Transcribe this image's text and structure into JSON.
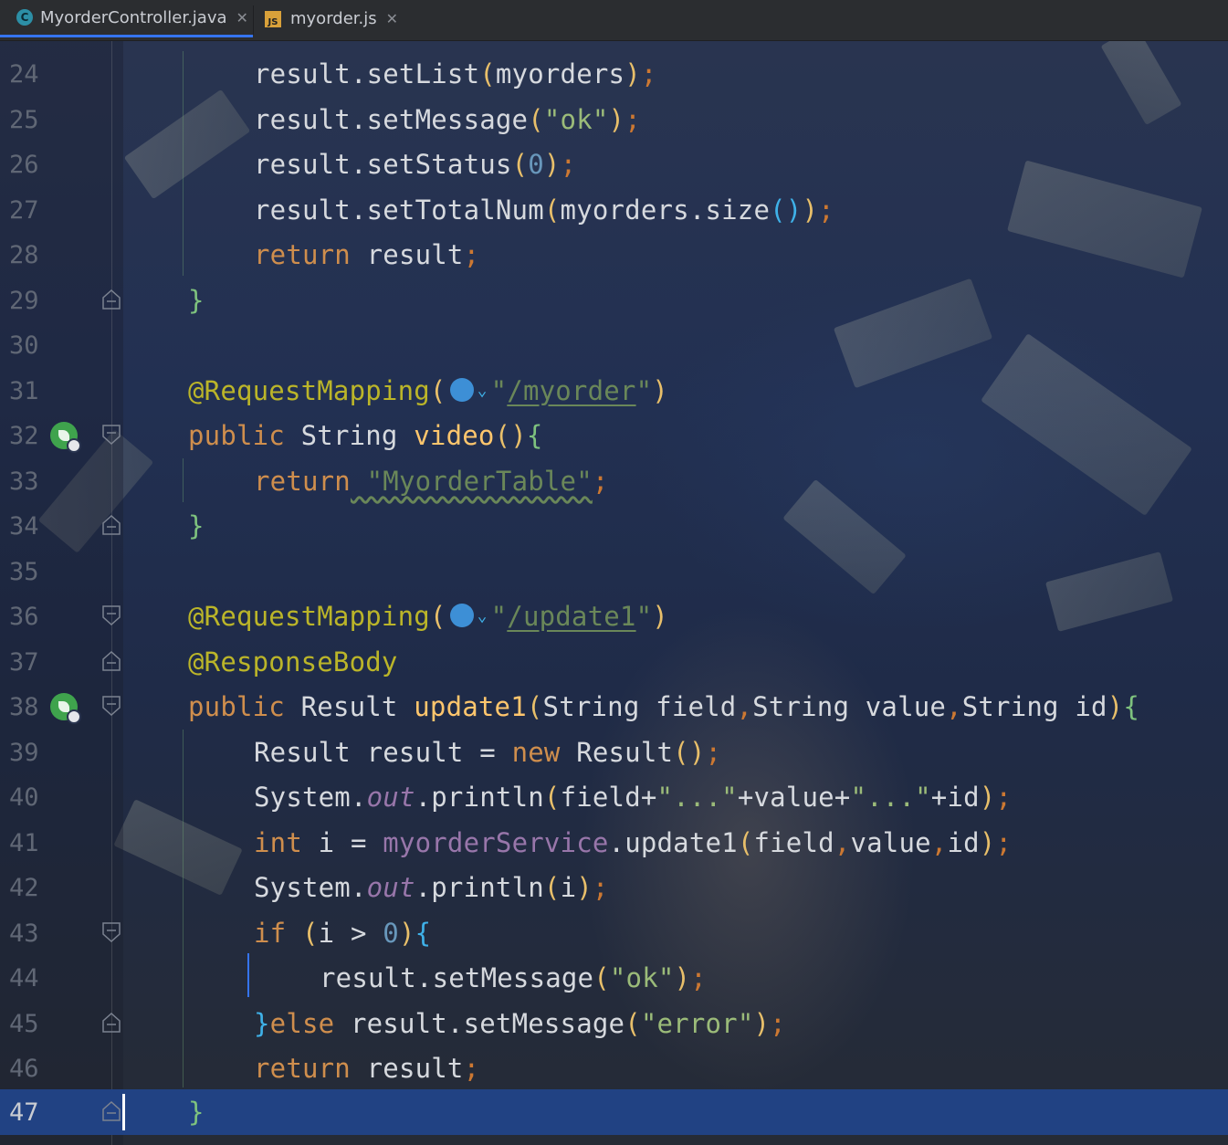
{
  "tabs": [
    {
      "label": "MyorderController.java",
      "icon": "java-class-icon",
      "icon_glyph": "C",
      "active": true
    },
    {
      "label": "myorder.js",
      "icon": "javascript-file-icon",
      "icon_glyph": "JS",
      "active": false
    }
  ],
  "close_glyph": "✕",
  "lines": [
    {
      "num": "24"
    },
    {
      "num": "25"
    },
    {
      "num": "26"
    },
    {
      "num": "27"
    },
    {
      "num": "28"
    },
    {
      "num": "29"
    },
    {
      "num": "30"
    },
    {
      "num": "31"
    },
    {
      "num": "32"
    },
    {
      "num": "33"
    },
    {
      "num": "34"
    },
    {
      "num": "35"
    },
    {
      "num": "36"
    },
    {
      "num": "37"
    },
    {
      "num": "38"
    },
    {
      "num": "39"
    },
    {
      "num": "40"
    },
    {
      "num": "41"
    },
    {
      "num": "42"
    },
    {
      "num": "43"
    },
    {
      "num": "44"
    },
    {
      "num": "45"
    },
    {
      "num": "46"
    },
    {
      "num": "47"
    }
  ],
  "code": {
    "l24": {
      "a": "result.setList",
      "b": "(",
      "c": "myorders",
      "d": ")",
      "e": ";"
    },
    "l25": {
      "a": "result.setMessage",
      "b": "(",
      "c": "\"ok\"",
      "d": ")",
      "e": ";"
    },
    "l26": {
      "a": "result.setStatus",
      "b": "(",
      "c": "0",
      "d": ")",
      "e": ";"
    },
    "l27": {
      "a": "result.setTotalNum",
      "b": "(",
      "c": "myorders.size",
      "d": "()",
      "e": ")",
      "f": ";"
    },
    "l28": {
      "kw": "return",
      "a": " result",
      "e": ";"
    },
    "l29": {
      "a": "}"
    },
    "l31": {
      "ann": "@RequestMapping",
      "b": "(",
      "q1": "\"",
      "path": "/myorder",
      "q2": "\"",
      "d": ")"
    },
    "l32": {
      "kw": "public",
      "type": " String ",
      "fn": "video",
      "b": "()",
      "c": "{"
    },
    "l33": {
      "kw": "return",
      "str": " \"MyorderTable\"",
      "e": ";"
    },
    "l34": {
      "a": "}"
    },
    "l36": {
      "ann": "@RequestMapping",
      "b": "(",
      "q1": "\"",
      "path": "/update1",
      "q2": "\"",
      "d": ")"
    },
    "l37": {
      "ann": "@ResponseBody"
    },
    "l38": {
      "kw": "public",
      "type": " Result ",
      "fn": "update1",
      "b": "(",
      "p1": "String field",
      "p2": "String value",
      "p3": "String id",
      "d": ")",
      "c": "{",
      "comma": ","
    },
    "l39": {
      "a": "Result result = ",
      "kw": "new",
      "b": " Result",
      "c": "()",
      "e": ";"
    },
    "l40": {
      "a": "System.",
      "fld": "out",
      "b": ".println",
      "c": "(",
      "d": "field+",
      "s1": "\"...\"",
      "f": "+value+",
      "s2": "\"...\"",
      "g": "+id",
      "h": ")",
      "e": ";"
    },
    "l41": {
      "kw": "int",
      "a": " i = ",
      "svc": "myorderService",
      "b": ".update1",
      "c": "(",
      "d": "field",
      "f": "value",
      "g": "id",
      "h": ")",
      "e": ";",
      "comma": ","
    },
    "l42": {
      "a": "System.",
      "fld": "out",
      "b": ".println",
      "c": "(",
      "d": "i",
      "h": ")",
      "e": ";"
    },
    "l43": {
      "kw": "if",
      "a": " (",
      "b": "i > ",
      "num": "0",
      "c": ")",
      "d": "{"
    },
    "l44": {
      "a": "result.setMessage",
      "b": "(",
      "c": "\"ok\"",
      "d": ")",
      "e": ";"
    },
    "l45": {
      "a": "}",
      "kw": "else",
      "b": " result.setMessage",
      "c": "(",
      "d": "\"error\"",
      "f": ")",
      "e": ";"
    },
    "l46": {
      "kw": "return",
      "a": " result",
      "e": ";"
    },
    "l47": {
      "a": "}"
    }
  },
  "colors": {
    "current_line": "#214283",
    "keyword": "#cf8e4d",
    "annotation": "#bbb529",
    "string": "#6a8759"
  }
}
